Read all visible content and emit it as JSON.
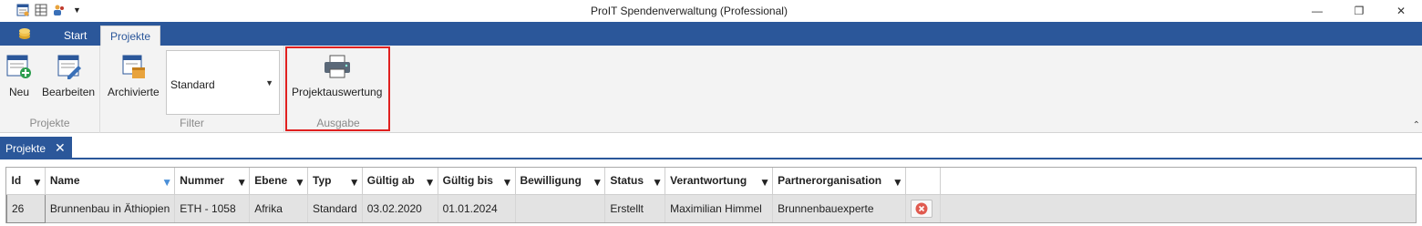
{
  "window": {
    "title": "ProIT Spendenverwaltung (Professional)",
    "minimize": "—",
    "restore": "❐",
    "close": "✕"
  },
  "ribbon_tabs": [
    {
      "label": "Start"
    },
    {
      "label": "Projekte"
    }
  ],
  "groups": {
    "projekte": {
      "label": "Projekte",
      "neu": "Neu",
      "bearbeiten": "Bearbeiten"
    },
    "filter": {
      "label": "Filter",
      "archivierte": "Archivierte",
      "combo_value": "Standard"
    },
    "ausgabe": {
      "label": "Ausgabe",
      "projektauswertung": "Projektauswertung"
    }
  },
  "doc_tab": {
    "label": "Projekte"
  },
  "grid": {
    "columns": [
      "Id",
      "Name",
      "Nummer",
      "Ebene",
      "Typ",
      "Gültig ab",
      "Gültig bis",
      "Bewilligung",
      "Status",
      "Verantwortung",
      "Partnerorganisation"
    ],
    "rows": [
      {
        "id": "26",
        "name": "Brunnenbau in Äthiopien",
        "nummer": "ETH - 1058",
        "ebene": "Afrika",
        "typ": "Standard",
        "gueltig_ab": "03.02.2020",
        "gueltig_bis": "01.01.2024",
        "bewilligung": "",
        "status": "Erstellt",
        "verantwortung": "Maximilian Himmel",
        "partnerorganisation": "Brunnenbauexperte"
      }
    ]
  },
  "colors": {
    "accent": "#2b579a",
    "highlight": "#e0201f",
    "delete": "#e05a4f"
  }
}
